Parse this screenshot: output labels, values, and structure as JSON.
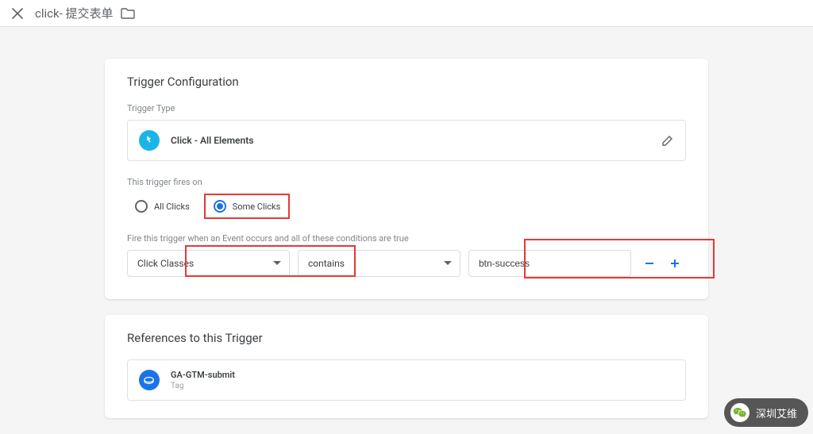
{
  "header": {
    "title": "click- 提交表单"
  },
  "config": {
    "title": "Trigger Configuration",
    "trigger_type_label": "Trigger Type",
    "trigger_type_value": "Click - All Elements",
    "fires_on_label": "This trigger fires on",
    "all_clicks_label": "All Clicks",
    "some_clicks_label": "Some Clicks",
    "condition_label": "Fire this trigger when an Event occurs and all of these conditions are true",
    "condition": {
      "variable": "Click Classes",
      "operator": "contains",
      "value": "btn-success"
    }
  },
  "references": {
    "title": "References to this Trigger",
    "items": [
      {
        "name": "GA-GTM-submit",
        "type": "Tag"
      }
    ]
  },
  "watermark": {
    "text": "深圳艾维"
  }
}
